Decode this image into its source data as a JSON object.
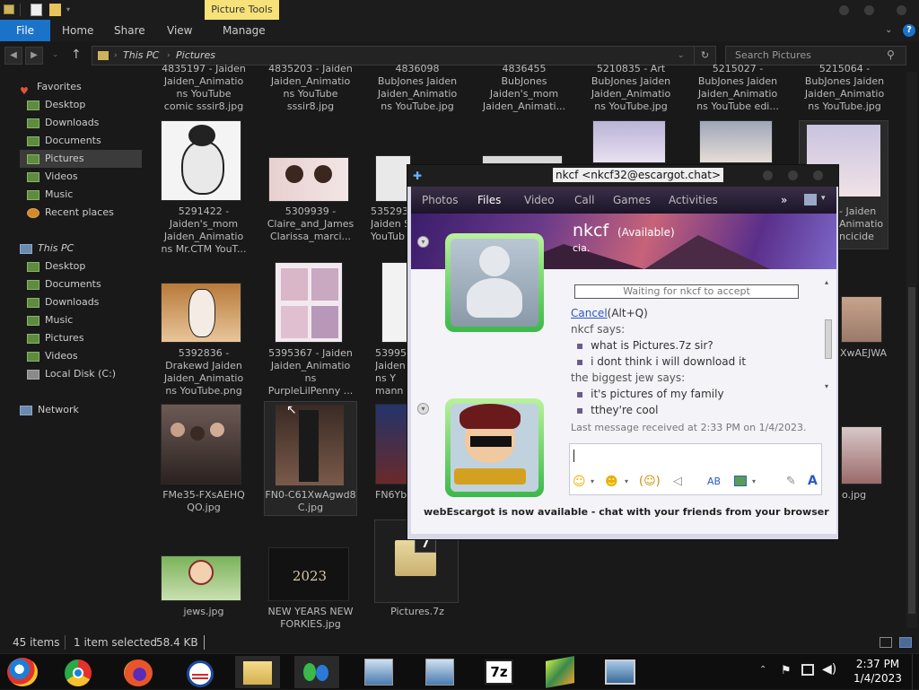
{
  "titlebar": {
    "context_tab": "Picture Tools"
  },
  "ribbon": {
    "tabs": [
      "File",
      "Home",
      "Share",
      "View",
      "Manage"
    ]
  },
  "address": {
    "path": [
      "This PC",
      "Pictures"
    ],
    "search_placeholder": "Search Pictures"
  },
  "sidebar": {
    "favorites": "Favorites",
    "fav_items": [
      "Desktop",
      "Downloads",
      "Documents",
      "Pictures",
      "Videos",
      "Music",
      "Recent places"
    ],
    "thispc": "This PC",
    "pc_items": [
      "Desktop",
      "Documents",
      "Downloads",
      "Music",
      "Pictures",
      "Videos",
      "Local Disk (C:)"
    ],
    "network": "Network"
  },
  "files": {
    "row0": [
      [
        "4835197 - Jaiden",
        "Jaiden_Animatio",
        "ns YouTube",
        "comic sssir8.jpg"
      ],
      [
        "4835203 - Jaiden",
        "Jaiden_Animatio",
        "ns YouTube",
        "sssir8.jpg"
      ],
      [
        "4836098",
        "BubJones Jaiden",
        "Jaiden_Animatio",
        "ns YouTube.jpg"
      ],
      [
        "4836455",
        "BubJones",
        "Jaiden's_mom",
        "Jaiden_Animati..."
      ],
      [
        "5210835 - Art",
        "BubJones Jaiden",
        "Jaiden_Animatio",
        "ns YouTube.jpg"
      ],
      [
        "5215027 -",
        "BubJones Jaiden",
        "Jaiden_Animatio",
        "ns YouTube edi..."
      ],
      [
        "5215064 -",
        "BubJones Jaiden",
        "Jaiden_Animatio",
        "ns YouTube.jpg"
      ]
    ],
    "row1": [
      [
        "5291422 -",
        "Jaiden's_mom",
        "Jaiden_Animatio",
        "ns Mr.CTM YouT..."
      ],
      [
        "5309939 -",
        "Claire_and_James",
        "Clarissa_marci..."
      ],
      [
        "535293",
        "Jaiden Se",
        "YouTub"
      ],
      [
        "- Jaiden",
        "Animatio",
        "ncicide",
        "tcnicide.png"
      ]
    ],
    "row2": [
      [
        "5392836 -",
        "Drakewd Jaiden",
        "Jaiden_Animatio",
        "ns YouTube.png"
      ],
      [
        "5395367 - Jaiden",
        "Jaiden_Animatio",
        "ns",
        "PurpleLilPenny ..."
      ],
      [
        "539952",
        "Jaiden",
        "ns Y",
        "mann"
      ],
      [
        "XwAEJWA",
        "0.jpg"
      ]
    ],
    "row3": [
      [
        "FMe35-FXsAEHQ",
        "QO.jpg"
      ],
      [
        "FN0-C61XwAgwd8",
        "C.jpg"
      ],
      [
        "FN6Yb"
      ],
      [
        "o.jpg"
      ]
    ],
    "row4": [
      [
        "jews.jpg"
      ],
      [
        "NEW YEARS NEW",
        "FORKIES.jpg"
      ],
      [
        "Pictures.7z"
      ]
    ],
    "new_year_text": "2023",
    "archive_badge": "7"
  },
  "status": {
    "items": "45 items",
    "selected": "1 item selected",
    "size": "58.4 KB"
  },
  "chat": {
    "title": "nkcf <nkcf32@escargot.chat>",
    "tabs": [
      "Photos",
      "Files",
      "Video",
      "Call",
      "Games",
      "Activities"
    ],
    "more": "»",
    "contact_name": "nkcf",
    "contact_status": "(Available)",
    "contact_msg": "cia.",
    "waiting": "Waiting for nkcf to accept",
    "cancel_link": "Cancel",
    "cancel_shortcut": "(Alt+Q)",
    "sender1": "nkcf says:",
    "msgs1": [
      "what is Pictures.7z sir?",
      "i dont think i will download it"
    ],
    "sender2": "the biggest jew says:",
    "msgs2": [
      "it's pictures of my family",
      "tthey're cool"
    ],
    "last_msg": "Last message received at 2:33 PM on 1/4/2023.",
    "banner_ad": "webEscargot is now available - chat with your friends from your browser"
  },
  "taskbar": {
    "time": "2:37 PM",
    "date": "1/4/2023",
    "archive_app": "7z"
  },
  "colors": {
    "accent": "#1a72c9",
    "tools_tab": "#f7e27a",
    "link": "#2a56c6"
  }
}
